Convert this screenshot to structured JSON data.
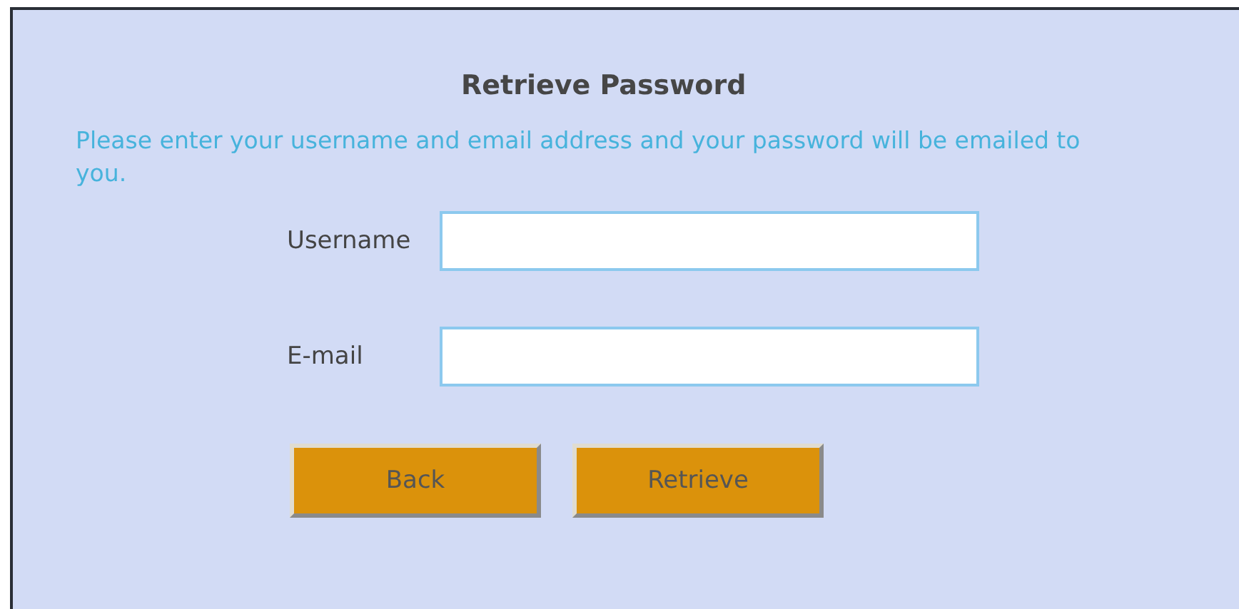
{
  "title": "Retrieve Password",
  "instructions": "Please enter your username and email address and your password will be emailed to you.",
  "fields": [
    {
      "label": "Username"
    },
    {
      "label": "E-mail"
    }
  ],
  "buttons": [
    "Back",
    "Retrieve"
  ]
}
